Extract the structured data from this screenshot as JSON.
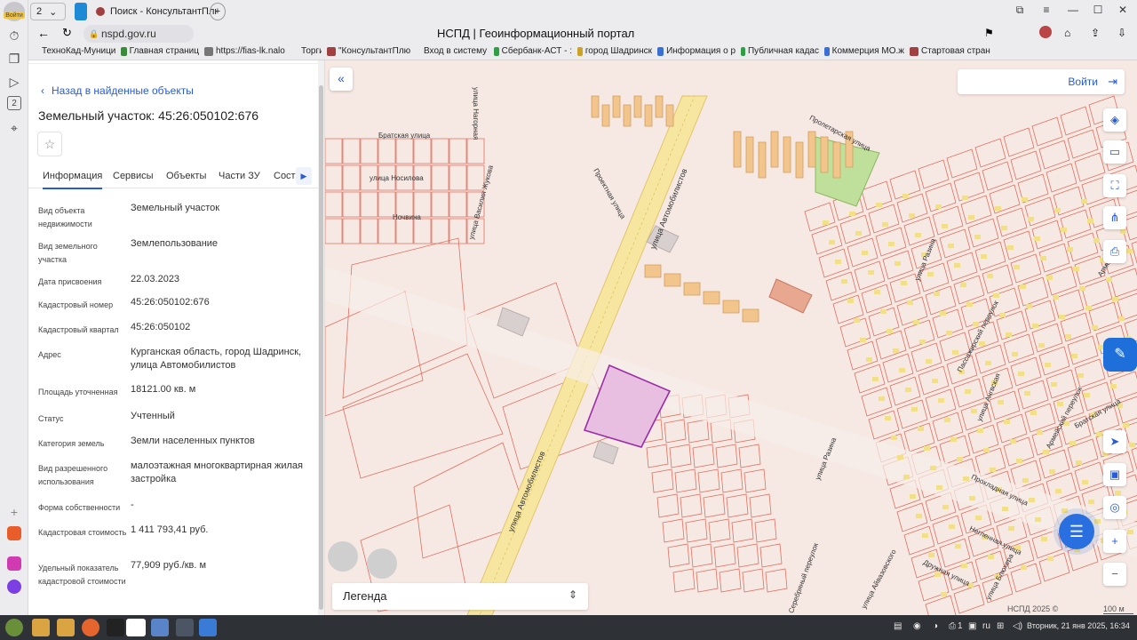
{
  "browser": {
    "window_title": "НСПД | Геоинформационный портал",
    "url": "nspd.gov.ru",
    "tab_count_badge": "2",
    "tabs": [
      {
        "label": "Поиск - КонсультантПлю"
      }
    ],
    "profile_label": "Войти",
    "rail_badge": "2"
  },
  "bookmarks": [
    {
      "label": "ТехноКад-Муници",
      "color": "#d84a2b"
    },
    {
      "label": "Главная страниц",
      "color": "#3b8a3b"
    },
    {
      "label": "https://fias-lk.nalo",
      "color": "#777777"
    },
    {
      "label": "Торги",
      "color": "#888888"
    },
    {
      "label": "\"КонсультантПлю",
      "color": "#a04040"
    },
    {
      "label": "Вход в систему :",
      "color": "#d14a2b"
    },
    {
      "label": "Сбербанк-АСТ - :",
      "color": "#2f9e44"
    },
    {
      "label": "город Шадринск",
      "color": "#c9a227"
    },
    {
      "label": "Информация о р",
      "color": "#3a6fd8"
    },
    {
      "label": "Публичная кадас",
      "color": "#2f9e44"
    },
    {
      "label": "Коммерция МО.ж",
      "color": "#3a6fd8"
    },
    {
      "label": "Стартовая стран",
      "color": "#a04040"
    }
  ],
  "panel": {
    "back_link": "Назад в найденные объекты",
    "title": "Земельный участок: 45:26:050102:676",
    "tabs": [
      "Информация",
      "Сервисы",
      "Объекты",
      "Части ЗУ",
      "Соста"
    ],
    "rows": [
      {
        "label": "Вид объекта недвижимости",
        "value": "Земельный участок"
      },
      {
        "label": "Вид земельного участка",
        "value": "Землепользование"
      },
      {
        "label": "Дата присвоения",
        "value": "22.03.2023"
      },
      {
        "label": "Кадастровый номер",
        "value": "45:26:050102:676"
      },
      {
        "label": "Кадастровый квартал",
        "value": "45:26:050102"
      },
      {
        "label": "Адрес",
        "value": "Курганская область, город Шадринск, улица Автомобилистов"
      },
      {
        "label": "Площадь уточненная",
        "value": "18121.00 кв. м"
      },
      {
        "label": "Статус",
        "value": "Учтенный"
      },
      {
        "label": "Категория земель",
        "value": "Земли населенных пунктов"
      },
      {
        "label": "Вид разрешенного использования",
        "value": "малоэтажная многоквартирная жилая застройка"
      },
      {
        "label": "Форма собственности",
        "value": "-"
      },
      {
        "label": "Кадастровая стоимость",
        "value": "1 411 793,41 руб."
      },
      {
        "label": "Удельный показатель кадастровой стоимости",
        "value": "77,909 руб./кв. м"
      }
    ]
  },
  "map": {
    "login": "Войти",
    "legend": "Легенда",
    "copyright": "НСПД 2025 ©",
    "scale": "100 м",
    "street_labels": [
      "Братская улица",
      "улица Нагорная",
      "улица Носилова",
      "Ночвина",
      "улица Василия Жукова",
      "Проектная улица",
      "улица Автомобилистов",
      "Пролетарская улица",
      "улица Разина",
      "Пассажирский переулок",
      "улица Ангвская",
      "Армейский переулок",
      "Братская улица",
      "Прохладная улица",
      "Негленная улица",
      "Дружная улица",
      "улица Блюхера",
      "Серебряный переулок",
      "улица Айвазовского",
      "Армейский"
    ],
    "colors": {
      "background": "#f6e8e3",
      "parcel_stroke": "#e07060",
      "road": "#f7e6a0",
      "selected_fill": "#e8bfe0",
      "selected_stroke": "#9b2da8",
      "building": "#f1c58c",
      "park": "#bfe09a"
    }
  },
  "taskbar": {
    "tray_lang": "ru",
    "tray_num": "1",
    "clock": "Вторник, 21 янв 2025, 16:34"
  }
}
